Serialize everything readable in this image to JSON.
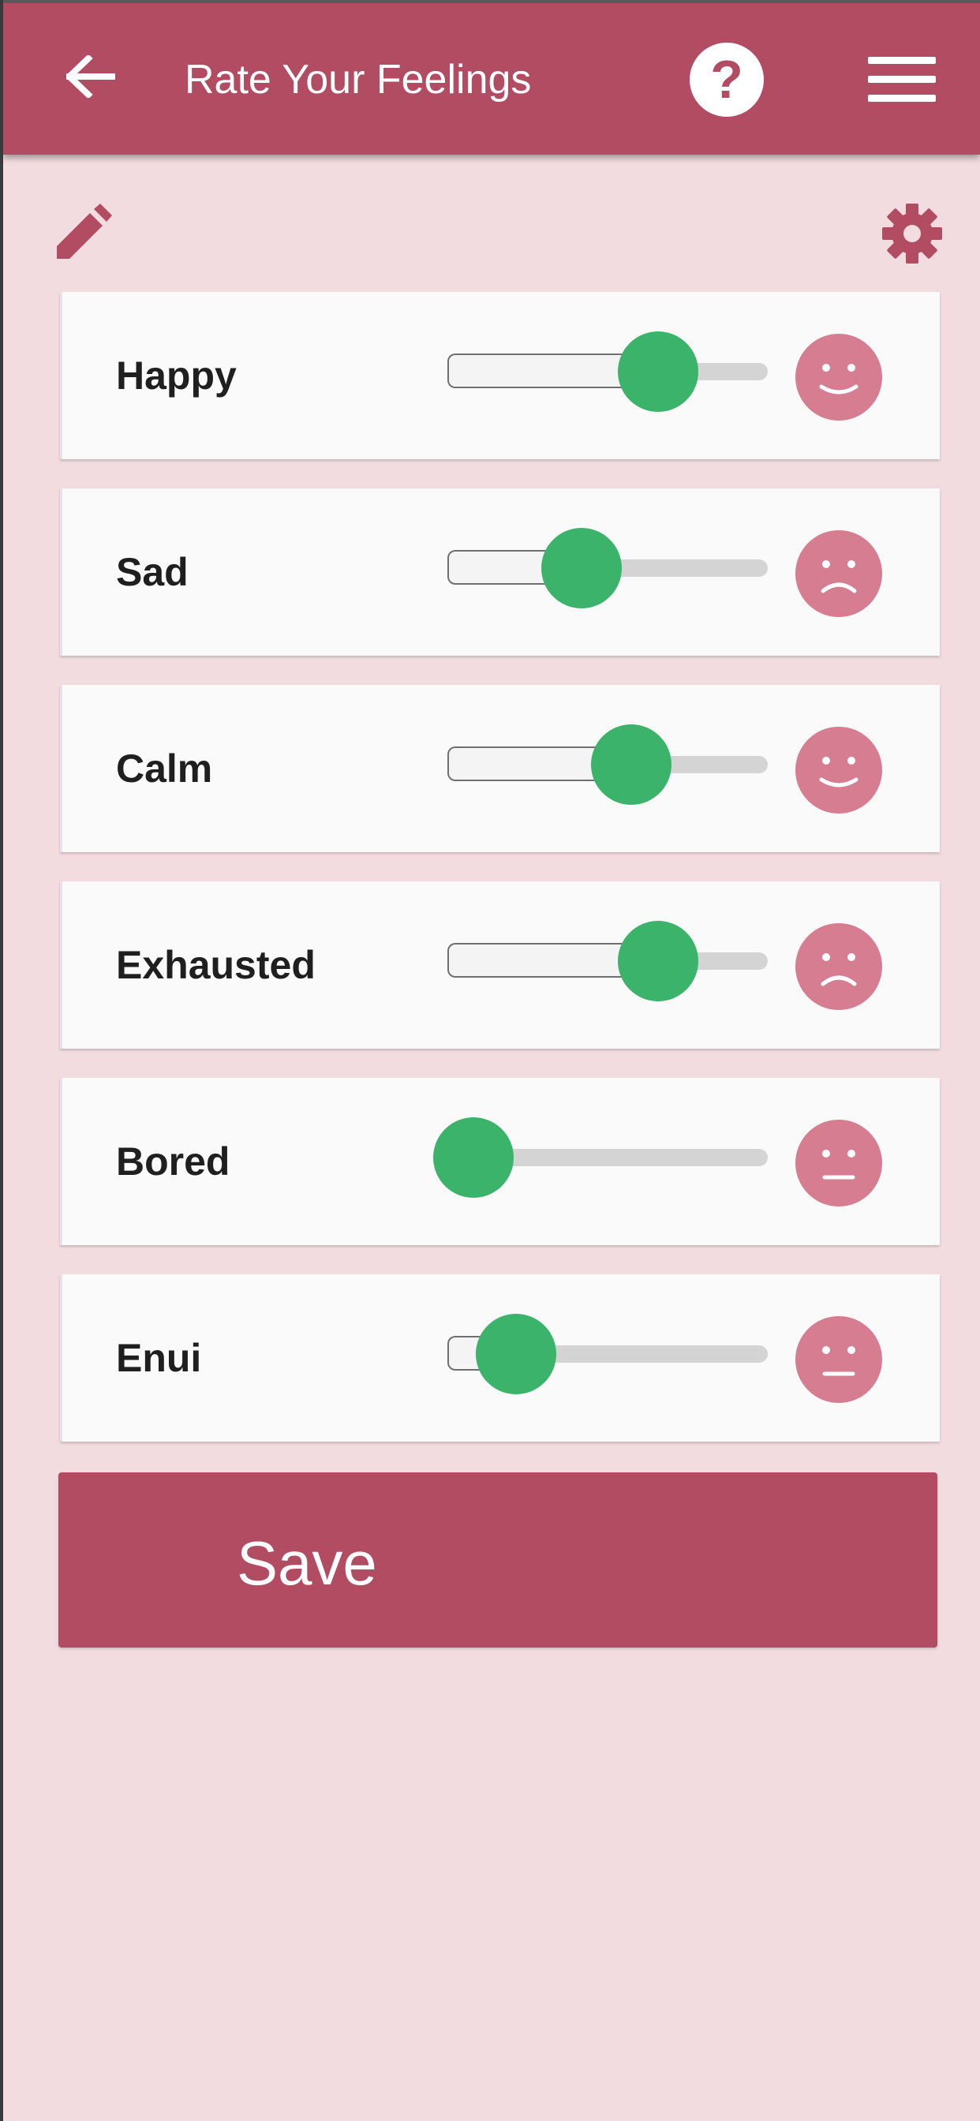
{
  "header": {
    "title": "Rate Your Feelings",
    "back_icon": "arrow-left-icon",
    "help_label": "?",
    "help_icon": "help-circle-icon",
    "menu_icon": "hamburger-menu-icon"
  },
  "toolbar": {
    "edit_icon": "pencil-icon",
    "settings_icon": "gear-icon"
  },
  "feelings": [
    {
      "label": "Happy",
      "value": 0.71,
      "face": "smile"
    },
    {
      "label": "Sad",
      "value": 0.39,
      "face": "frown"
    },
    {
      "label": "Calm",
      "value": 0.6,
      "face": "smile"
    },
    {
      "label": "Exhausted",
      "value": 0.71,
      "face": "frown"
    },
    {
      "label": "Bored",
      "value": 0.0,
      "face": "neutral"
    },
    {
      "label": "Enui",
      "value": 0.12,
      "face": "neutral"
    }
  ],
  "actions": {
    "save_label": "Save"
  },
  "colors": {
    "primary": "#b24c62",
    "background": "#f2dce0",
    "card": "#fafafa",
    "thumb": "#3bb36a",
    "face": "#d67d92"
  }
}
